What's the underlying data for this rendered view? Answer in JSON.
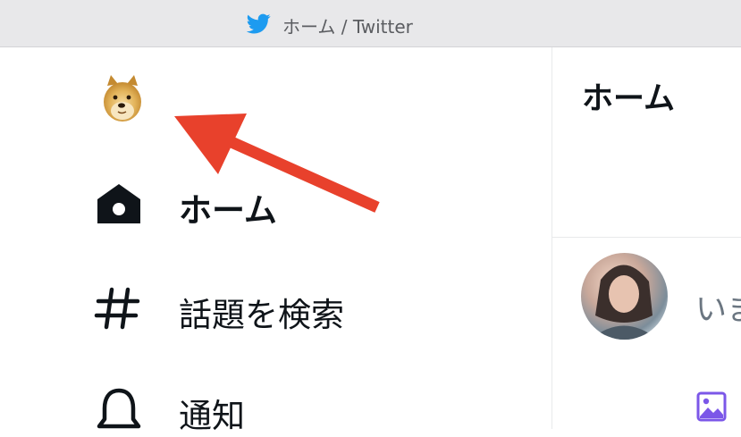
{
  "window": {
    "title": "ホーム / Twitter",
    "icon": "twitter-bird-icon"
  },
  "sidebar": {
    "logo": "doge-logo-icon",
    "items": [
      {
        "label": "ホーム",
        "icon": "home-icon",
        "active": true
      },
      {
        "label": "話題を検索",
        "icon": "hashtag-icon",
        "active": false
      },
      {
        "label": "通知",
        "icon": "bell-icon",
        "active": false
      }
    ]
  },
  "main": {
    "title": "ホーム",
    "composer": {
      "placeholder": "いま",
      "media_icon": "image-icon"
    }
  },
  "annotation": {
    "type": "red-arrow",
    "points_to": "doge-logo"
  },
  "colors": {
    "twitter_blue": "#1d9bf0",
    "arrow_red": "#e8412c",
    "media_purple": "#7b57e8",
    "text": "#0f1419",
    "placeholder": "#6b7681"
  }
}
